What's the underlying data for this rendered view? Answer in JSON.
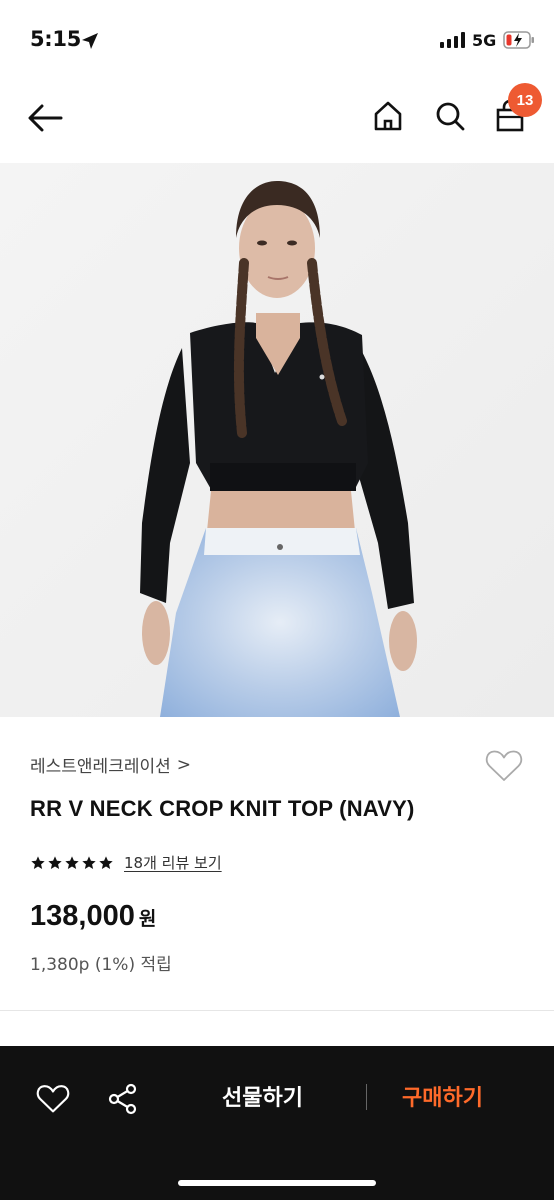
{
  "status_bar": {
    "time": "5:15",
    "network": "5G"
  },
  "nav": {
    "cart_count": "13"
  },
  "product": {
    "brand": "레스트앤레크레이션",
    "brand_chevron": ">",
    "title": "RR V NECK CROP KNIT TOP (NAVY)",
    "rating_stars": 5,
    "review_link": "18개 리뷰 보기",
    "price": "138,000",
    "currency": "원",
    "points": "1,380p (1%) 적립"
  },
  "bottom_bar": {
    "gift_label": "선물하기",
    "buy_label": "구매하기"
  },
  "colors": {
    "accent": "#ee5a32",
    "buy": "#ff6a2a",
    "bar_bg": "#111111"
  }
}
